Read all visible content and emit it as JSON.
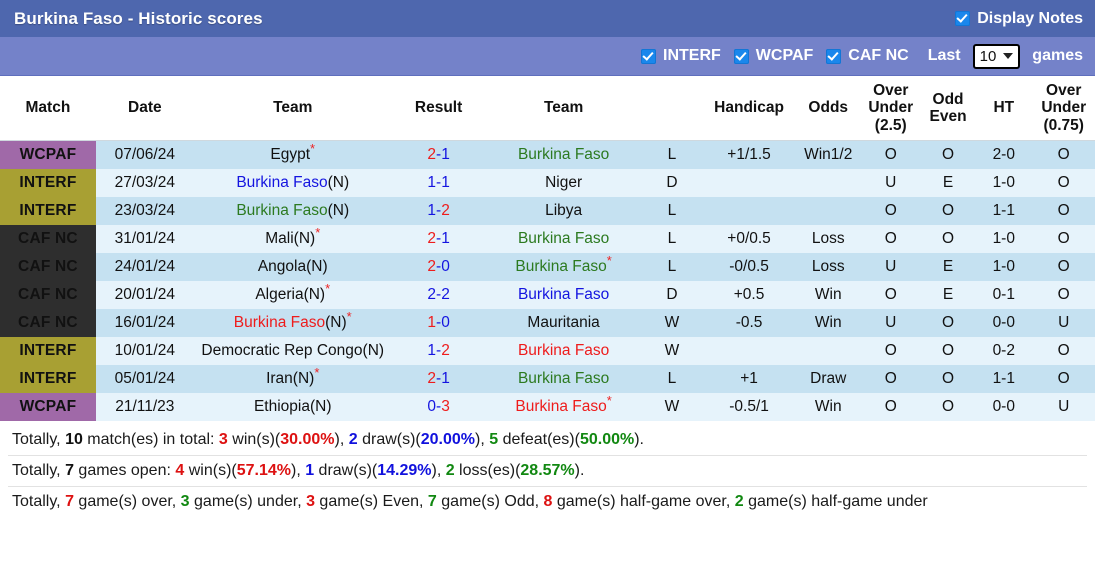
{
  "header": {
    "title": "Burkina Faso - Historic scores",
    "display_notes_label": "Display Notes",
    "display_notes_checked": true
  },
  "filters": {
    "items": [
      {
        "label": "INTERF",
        "checked": true
      },
      {
        "label": "WCPAF",
        "checked": true
      },
      {
        "label": "CAF NC",
        "checked": true
      }
    ],
    "last_label": "Last",
    "count_value": "10",
    "games_label": "games"
  },
  "columns": [
    {
      "key": "match",
      "label": "Match"
    },
    {
      "key": "date",
      "label": "Date"
    },
    {
      "key": "home",
      "label": "Team"
    },
    {
      "key": "result",
      "label": "Result"
    },
    {
      "key": "away",
      "label": "Team"
    },
    {
      "key": "wdl",
      "label": ""
    },
    {
      "key": "handicap",
      "label": "Handicap"
    },
    {
      "key": "odds",
      "label": "Odds"
    },
    {
      "key": "ou25",
      "label": "Over Under (2.5)"
    },
    {
      "key": "oddeven",
      "label": "Odd Even"
    },
    {
      "key": "ht",
      "label": "HT"
    },
    {
      "key": "ou075",
      "label": "Over Under (0.75)"
    }
  ],
  "badge_colors": {
    "WCPAF": "#a069a8",
    "INTERF": "#a8a033",
    "CAF NC": "#2e2e2e"
  },
  "rows": [
    {
      "match": "WCPAF",
      "date": "07/06/24",
      "home": {
        "name": "Egypt",
        "suffix": "",
        "star": true,
        "color": "c-black"
      },
      "score": {
        "h": "2",
        "a": "1",
        "h_color": "c-red",
        "a_color": "c-blue"
      },
      "away": {
        "name": "Burkina Faso",
        "suffix": "",
        "star": false,
        "color": "c-green"
      },
      "wdl": {
        "text": "L",
        "color": "c-green"
      },
      "handicap": "+1/1.5",
      "odds": {
        "text": "Win1/2",
        "color": "c-red"
      },
      "ou25": {
        "text": "O",
        "color": "c-red"
      },
      "oddeven": {
        "text": "O",
        "color": "c-green"
      },
      "ht": "2-0",
      "ou075": {
        "text": "O",
        "color": "c-red"
      }
    },
    {
      "match": "INTERF",
      "date": "27/03/24",
      "home": {
        "name": "Burkina Faso",
        "suffix": "(N)",
        "star": false,
        "color": "c-blue"
      },
      "score": {
        "h": "1",
        "a": "1",
        "h_color": "c-blue",
        "a_color": "c-blue"
      },
      "away": {
        "name": "Niger",
        "suffix": "",
        "star": false,
        "color": "c-black"
      },
      "wdl": {
        "text": "D",
        "color": "c-blue"
      },
      "handicap": "",
      "odds": {
        "text": "",
        "color": "c-black"
      },
      "ou25": {
        "text": "U",
        "color": "c-green"
      },
      "oddeven": {
        "text": "E",
        "color": "c-red"
      },
      "ht": "1-0",
      "ou075": {
        "text": "O",
        "color": "c-red"
      }
    },
    {
      "match": "INTERF",
      "date": "23/03/24",
      "home": {
        "name": "Burkina Faso",
        "suffix": "(N)",
        "star": false,
        "color": "c-green"
      },
      "score": {
        "h": "1",
        "a": "2",
        "h_color": "c-blue",
        "a_color": "c-red"
      },
      "away": {
        "name": "Libya",
        "suffix": "",
        "star": false,
        "color": "c-black"
      },
      "wdl": {
        "text": "L",
        "color": "c-green"
      },
      "handicap": "",
      "odds": {
        "text": "",
        "color": "c-black"
      },
      "ou25": {
        "text": "O",
        "color": "c-red"
      },
      "oddeven": {
        "text": "O",
        "color": "c-green"
      },
      "ht": "1-1",
      "ou075": {
        "text": "O",
        "color": "c-red"
      }
    },
    {
      "match": "CAF NC",
      "date": "31/01/24",
      "home": {
        "name": "Mali",
        "suffix": "(N)",
        "star": true,
        "color": "c-black"
      },
      "score": {
        "h": "2",
        "a": "1",
        "h_color": "c-red",
        "a_color": "c-blue"
      },
      "away": {
        "name": "Burkina Faso",
        "suffix": "",
        "star": false,
        "color": "c-green"
      },
      "wdl": {
        "text": "L",
        "color": "c-green"
      },
      "handicap": "+0/0.5",
      "odds": {
        "text": "Loss",
        "color": "c-green"
      },
      "ou25": {
        "text": "O",
        "color": "c-red"
      },
      "oddeven": {
        "text": "O",
        "color": "c-green"
      },
      "ht": "1-0",
      "ou075": {
        "text": "O",
        "color": "c-red"
      }
    },
    {
      "match": "CAF NC",
      "date": "24/01/24",
      "home": {
        "name": "Angola",
        "suffix": "(N)",
        "star": false,
        "color": "c-black"
      },
      "score": {
        "h": "2",
        "a": "0",
        "h_color": "c-red",
        "a_color": "c-blue"
      },
      "away": {
        "name": "Burkina Faso",
        "suffix": "",
        "star": true,
        "color": "c-green"
      },
      "wdl": {
        "text": "L",
        "color": "c-green"
      },
      "handicap": "-0/0.5",
      "odds": {
        "text": "Loss",
        "color": "c-green"
      },
      "ou25": {
        "text": "U",
        "color": "c-green"
      },
      "oddeven": {
        "text": "E",
        "color": "c-red"
      },
      "ht": "1-0",
      "ou075": {
        "text": "O",
        "color": "c-red"
      }
    },
    {
      "match": "CAF NC",
      "date": "20/01/24",
      "home": {
        "name": "Algeria",
        "suffix": "(N)",
        "star": true,
        "color": "c-black"
      },
      "score": {
        "h": "2",
        "a": "2",
        "h_color": "c-blue",
        "a_color": "c-blue"
      },
      "away": {
        "name": "Burkina Faso",
        "suffix": "",
        "star": false,
        "color": "c-blue"
      },
      "wdl": {
        "text": "D",
        "color": "c-blue"
      },
      "handicap": "+0.5",
      "odds": {
        "text": "Win",
        "color": "c-red"
      },
      "ou25": {
        "text": "O",
        "color": "c-red"
      },
      "oddeven": {
        "text": "E",
        "color": "c-red"
      },
      "ht": "0-1",
      "ou075": {
        "text": "O",
        "color": "c-red"
      }
    },
    {
      "match": "CAF NC",
      "date": "16/01/24",
      "home": {
        "name": "Burkina Faso",
        "suffix": "(N)",
        "star": true,
        "color": "c-red"
      },
      "score": {
        "h": "1",
        "a": "0",
        "h_color": "c-red",
        "a_color": "c-blue"
      },
      "away": {
        "name": "Mauritania",
        "suffix": "",
        "star": false,
        "color": "c-black"
      },
      "wdl": {
        "text": "W",
        "color": "c-red"
      },
      "handicap": "-0.5",
      "odds": {
        "text": "Win",
        "color": "c-red"
      },
      "ou25": {
        "text": "U",
        "color": "c-green"
      },
      "oddeven": {
        "text": "O",
        "color": "c-green"
      },
      "ht": "0-0",
      "ou075": {
        "text": "U",
        "color": "c-green"
      }
    },
    {
      "match": "INTERF",
      "date": "10/01/24",
      "home": {
        "name": "Democratic Rep Congo",
        "suffix": "(N)",
        "star": false,
        "color": "c-black"
      },
      "score": {
        "h": "1",
        "a": "2",
        "h_color": "c-blue",
        "a_color": "c-red"
      },
      "away": {
        "name": "Burkina Faso",
        "suffix": "",
        "star": false,
        "color": "c-red"
      },
      "wdl": {
        "text": "W",
        "color": "c-red"
      },
      "handicap": "",
      "odds": {
        "text": "",
        "color": "c-black"
      },
      "ou25": {
        "text": "O",
        "color": "c-red"
      },
      "oddeven": {
        "text": "O",
        "color": "c-green"
      },
      "ht": "0-2",
      "ou075": {
        "text": "O",
        "color": "c-red"
      }
    },
    {
      "match": "INTERF",
      "date": "05/01/24",
      "home": {
        "name": "Iran",
        "suffix": "(N)",
        "star": true,
        "color": "c-black"
      },
      "score": {
        "h": "2",
        "a": "1",
        "h_color": "c-red",
        "a_color": "c-blue"
      },
      "away": {
        "name": "Burkina Faso",
        "suffix": "",
        "star": false,
        "color": "c-green"
      },
      "wdl": {
        "text": "L",
        "color": "c-green"
      },
      "handicap": "+1",
      "odds": {
        "text": "Draw",
        "color": "c-blue"
      },
      "ou25": {
        "text": "O",
        "color": "c-red"
      },
      "oddeven": {
        "text": "O",
        "color": "c-green"
      },
      "ht": "1-1",
      "ou075": {
        "text": "O",
        "color": "c-red"
      }
    },
    {
      "match": "WCPAF",
      "date": "21/11/23",
      "home": {
        "name": "Ethiopia",
        "suffix": "(N)",
        "star": false,
        "color": "c-black"
      },
      "score": {
        "h": "0",
        "a": "3",
        "h_color": "c-blue",
        "a_color": "c-red"
      },
      "away": {
        "name": "Burkina Faso",
        "suffix": "",
        "star": true,
        "color": "c-red"
      },
      "wdl": {
        "text": "W",
        "color": "c-red"
      },
      "handicap": "-0.5/1",
      "odds": {
        "text": "Win",
        "color": "c-red"
      },
      "ou25": {
        "text": "O",
        "color": "c-red"
      },
      "oddeven": {
        "text": "O",
        "color": "c-green"
      },
      "ht": "0-0",
      "ou075": {
        "text": "U",
        "color": "c-green"
      }
    }
  ],
  "summary": {
    "line1": {
      "prefix": "Totally, ",
      "total": "10",
      "mid1": " match(es) in total: ",
      "wins": "3",
      "wins_text": " win(s)(",
      "wins_pct": "30.00%",
      "mid2": "), ",
      "draws": "2",
      "draws_text": " draw(s)(",
      "draws_pct": "20.00%",
      "mid3": "), ",
      "defeats": "5",
      "defeats_text": " defeat(es)(",
      "defeats_pct": "50.00%",
      "suffix": ")."
    },
    "line2": {
      "prefix": "Totally, ",
      "open": "7",
      "mid1": " games open: ",
      "wins": "4",
      "wins_text": " win(s)(",
      "wins_pct": "57.14%",
      "mid2": "), ",
      "draws": "1",
      "draws_text": " draw(s)(",
      "draws_pct": "14.29%",
      "mid3": "), ",
      "losses": "2",
      "losses_text": " loss(es)(",
      "losses_pct": "28.57%",
      "suffix": ")."
    },
    "line3": {
      "prefix": "Totally, ",
      "over": "7",
      "over_text": " game(s) over, ",
      "under": "3",
      "under_text": " game(s) under, ",
      "even": "3",
      "even_text": " game(s) Even, ",
      "odd": "7",
      "odd_text": " game(s) Odd, ",
      "half_over": "8",
      "half_over_text": " game(s) half-game over, ",
      "half_under": "2",
      "half_under_text": " game(s) half-game under"
    }
  }
}
